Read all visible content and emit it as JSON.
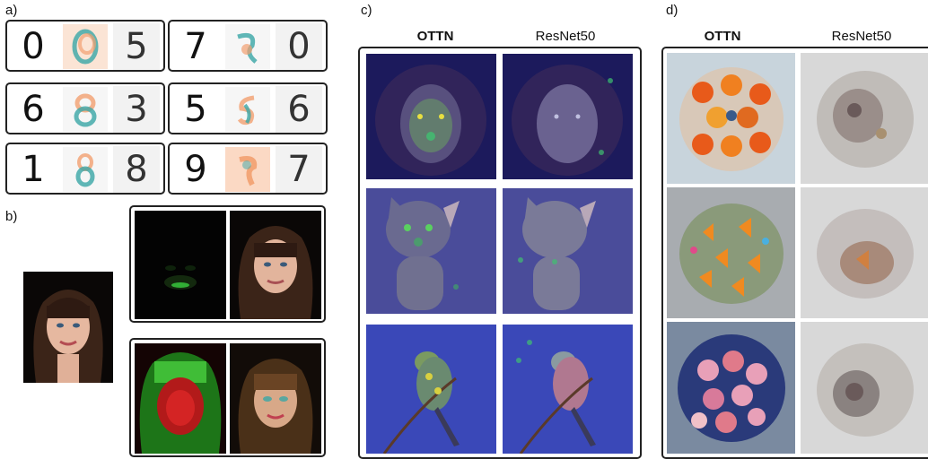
{
  "panels": {
    "a": {
      "label": "a)"
    },
    "b": {
      "label": "b)"
    },
    "c": {
      "label": "c)",
      "col_left": "OTTN",
      "col_right": "ResNet50"
    },
    "d": {
      "label": "d)",
      "col_left": "OTTN",
      "col_right": "ResNet50"
    }
  },
  "mnist_rows": [
    {
      "left": {
        "from": "0",
        "to": "5"
      },
      "right": {
        "from": "7",
        "to": "0"
      }
    },
    {
      "left": {
        "from": "6",
        "to": "3"
      },
      "right": {
        "from": "5",
        "to": "6"
      }
    },
    {
      "left": {
        "from": "1",
        "to": "8"
      },
      "right": {
        "from": "9",
        "to": "7"
      }
    }
  ],
  "colors": {
    "frame": "#222222",
    "saliency_bg": "#2a2f8a",
    "attribution_pos": "#f2a070",
    "attribution_neg": "#3aa6a6"
  }
}
